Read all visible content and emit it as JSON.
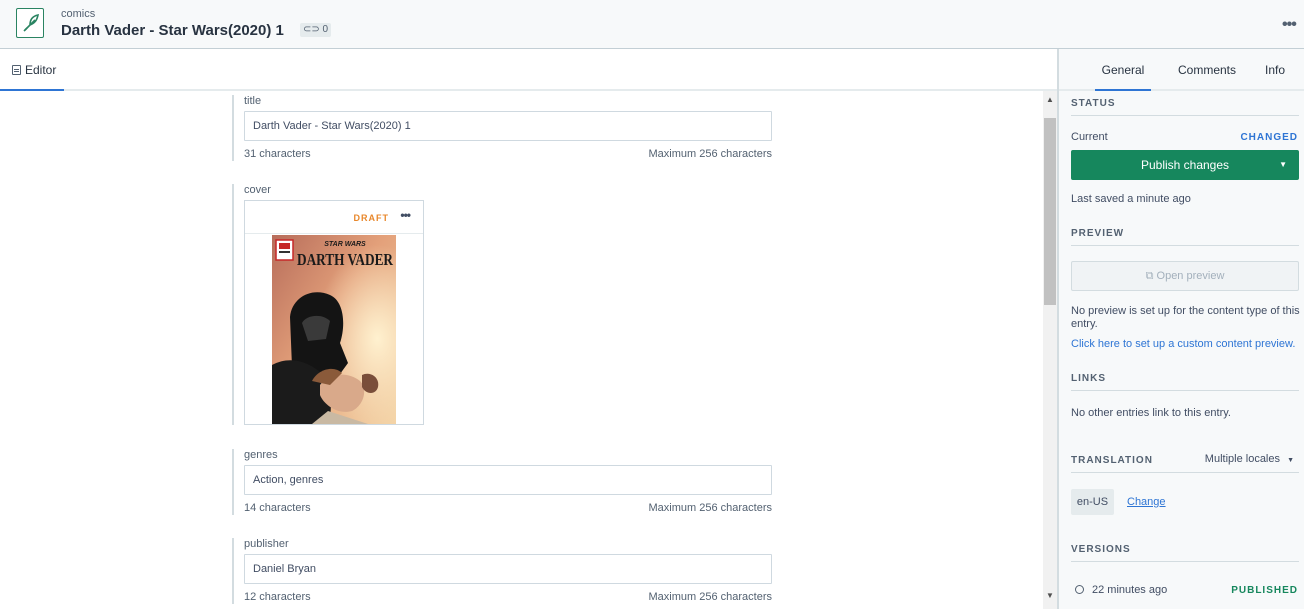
{
  "header": {
    "content_type": "comics",
    "title": "Darth Vader - Star Wars(2020) 1",
    "link_count": "0",
    "more_icon": "more-horizontal-icon"
  },
  "editor_tab": {
    "label": "Editor"
  },
  "fields": {
    "title": {
      "label": "title",
      "value": "Darth Vader - Star Wars(2020) 1",
      "count": "31 characters",
      "max": "Maximum 256 characters"
    },
    "cover": {
      "label": "cover",
      "status": "DRAFT",
      "brand_small": "STAR WARS",
      "brand_big": "DARTH VADER"
    },
    "genres": {
      "label": "genres",
      "value": "Action, genres",
      "count": "14 characters",
      "max": "Maximum 256 characters"
    },
    "publisher": {
      "label": "publisher",
      "value": "Daniel Bryan",
      "count": "12 characters",
      "max": "Maximum 256 characters"
    }
  },
  "sidebar": {
    "tabs": [
      "General",
      "Comments",
      "Info"
    ],
    "status": {
      "title": "STATUS",
      "current_label": "Current",
      "changed": "CHANGED",
      "publish_button": "Publish changes",
      "last_saved": "Last saved a minute ago"
    },
    "preview": {
      "title": "PREVIEW",
      "button": "Open preview",
      "note": "No preview is set up for the content type of this entry.",
      "link": "Click here to set up a custom content preview."
    },
    "links": {
      "title": "LINKS",
      "text": "No other entries link to this entry."
    },
    "translation": {
      "title": "TRANSLATION",
      "mode": "Multiple locales",
      "locale": "en-US",
      "change_link": "Change"
    },
    "versions": {
      "title": "VERSIONS",
      "time": "22 minutes ago",
      "status": "PUBLISHED"
    }
  },
  "colors": {
    "accent_blue": "#2e75d4",
    "publish_green": "#16875d",
    "draft_orange": "#e8872b"
  }
}
